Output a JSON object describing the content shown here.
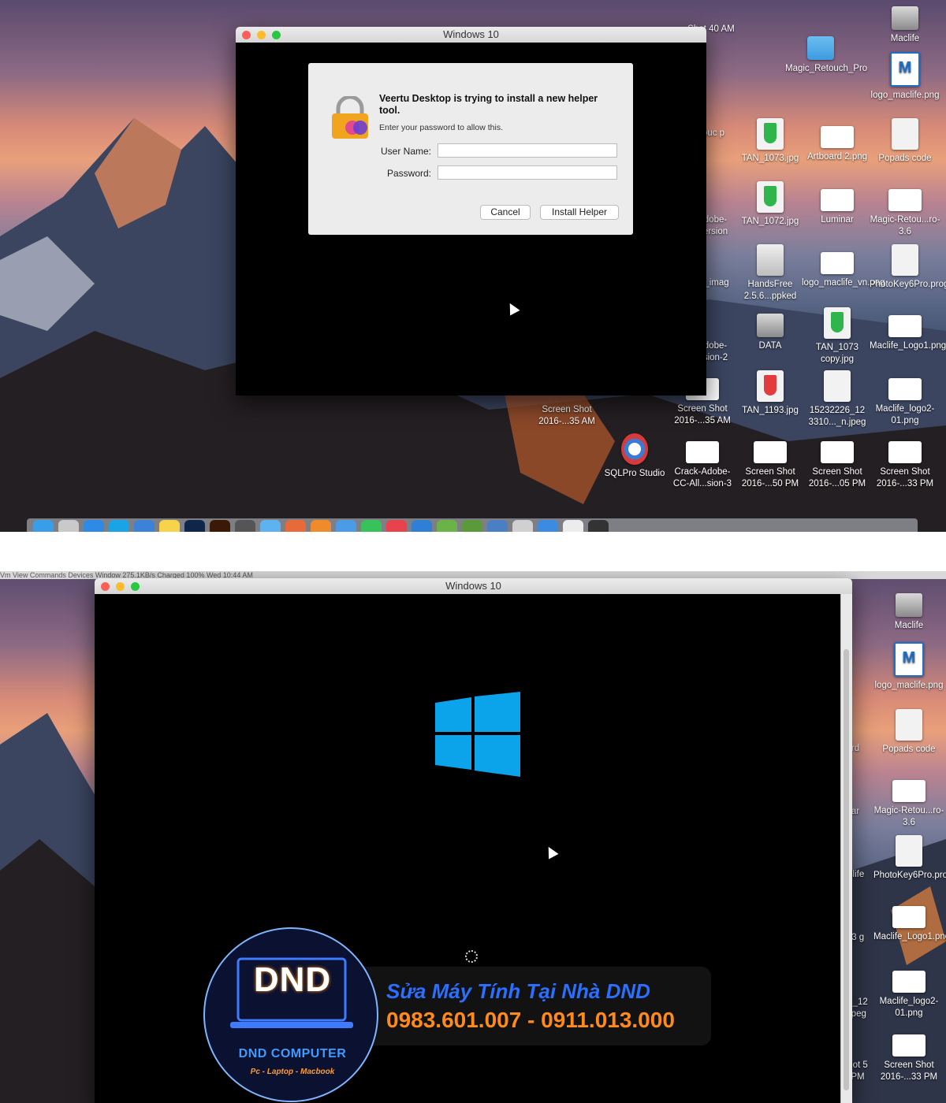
{
  "top": {
    "window_title": "Windows 10",
    "dialog": {
      "title": "Veertu Desktop is trying to install a new helper tool.",
      "subtitle": "Enter your password to allow this.",
      "username_label": "User Name:",
      "password_label": "Password:",
      "username_value": "",
      "password_value": "",
      "cancel_label": "Cancel",
      "install_label": "Install Helper"
    },
    "desktop_icons": [
      {
        "label": "Maclife",
        "icon": "drive-icon"
      },
      {
        "label": "Shot 40 AM",
        "icon": "screenshot-icon"
      },
      {
        "label": "Magic_Retouch_Pro",
        "icon": "folder-icon"
      },
      {
        "label": "logo_maclife.png",
        "icon": "image-icon"
      },
      {
        "label": "ouc p",
        "icon": "file-icon"
      },
      {
        "label": "TAN_1073.jpg",
        "icon": "image-icon"
      },
      {
        "label": "Artboard 2.png",
        "icon": "image-icon"
      },
      {
        "label": "Popads code",
        "icon": "file-icon"
      },
      {
        "label": "dobe- ersion",
        "icon": "file-icon"
      },
      {
        "label": "TAN_1072.jpg",
        "icon": "image-icon"
      },
      {
        "label": "Luminar",
        "icon": "app-icon"
      },
      {
        "label": "Magic-Retou...ro-3.6",
        "icon": "file-icon"
      },
      {
        "label": "_imag",
        "icon": "file-icon"
      },
      {
        "label": "HandsFree 2.5.6...ppked",
        "icon": "app-icon"
      },
      {
        "label": "logo_maclife_vn.png",
        "icon": "image-icon"
      },
      {
        "label": "PhotoKey6Pro.programKey",
        "icon": "file-icon"
      },
      {
        "label": "dobe- sion-2",
        "icon": "file-icon"
      },
      {
        "label": "DATA",
        "icon": "drive-icon"
      },
      {
        "label": "TAN_1073 copy.jpg",
        "icon": "image-icon"
      },
      {
        "label": "Maclife_Logo1.png",
        "icon": "image-icon"
      },
      {
        "label": "Screen Shot 2016-...35 AM",
        "icon": "screenshot-icon"
      },
      {
        "label": "Screen Shot 2016-...35 AM",
        "icon": "screenshot-icon"
      },
      {
        "label": "TAN_1193.jpg",
        "icon": "image-icon"
      },
      {
        "label": "15232226_12 3310..._n.jpeg",
        "icon": "image-icon"
      },
      {
        "label": "Maclife_logo2-01.png",
        "icon": "image-icon"
      },
      {
        "label": "SQLPro Studio",
        "icon": "app-icon"
      },
      {
        "label": "Crack-Adobe-CC-All...sion-3",
        "icon": "file-icon"
      },
      {
        "label": "Screen Shot 2016-...50 PM",
        "icon": "screenshot-icon"
      },
      {
        "label": "Screen Shot 2016-...05 PM",
        "icon": "screenshot-icon"
      },
      {
        "label": "Screen Shot 2016-...33 PM",
        "icon": "screenshot-icon"
      }
    ]
  },
  "bottom": {
    "window_title": "Windows 10",
    "menubar_ghost": "Vm   View   Commands   Devices   Window        275.1KB/s        Charged        100%        Wed 10:44 AM",
    "desktop_icons": [
      {
        "label": "Maclife",
        "icon": "drive-icon"
      },
      {
        "label": "logo_maclife.png",
        "icon": "image-icon"
      },
      {
        "label": "Popads code",
        "icon": "file-icon"
      },
      {
        "label": "rd",
        "icon": "file-icon"
      },
      {
        "label": "Magic-Retou...ro-3.6",
        "icon": "file-icon"
      },
      {
        "label": "ar",
        "icon": "file-icon"
      },
      {
        "label": "PhotoKey6Pro.programKey",
        "icon": "file-icon"
      },
      {
        "label": "clife",
        "icon": "file-icon"
      },
      {
        "label": "Maclife_Logo1.png",
        "icon": "image-icon"
      },
      {
        "label": "73 g",
        "icon": "file-icon"
      },
      {
        "label": "Maclife_logo2-01.png",
        "icon": "image-icon"
      },
      {
        "label": "6_12 jpeg",
        "icon": "file-icon"
      },
      {
        "label": "Screen Shot 2016-...33 PM",
        "icon": "screenshot-icon"
      },
      {
        "label": "hot 5 PM",
        "icon": "file-icon"
      }
    ]
  },
  "watermark": {
    "logo_text": "DND",
    "brand": "DND COMPUTER",
    "tagline": "Pc - Laptop - Macbook",
    "line1": "Sửa Máy Tính Tại Nhà DND",
    "line2": "0983.601.007 - 0911.013.000"
  },
  "colors": {
    "windows_blue": "#0ba3ea",
    "close": "#fc5f57",
    "minimize": "#fdbc2e",
    "maximize": "#28c840"
  }
}
